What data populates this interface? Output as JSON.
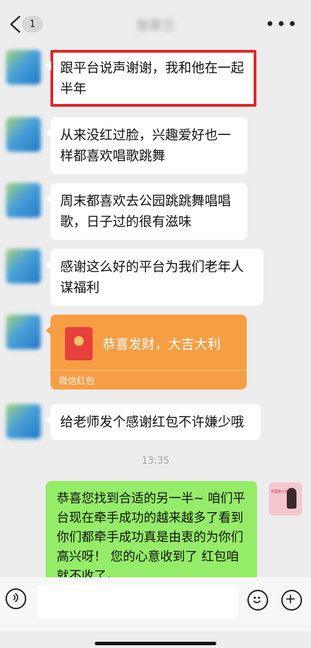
{
  "header": {
    "badge_count": "1",
    "title": "张翠兰"
  },
  "messages": [
    {
      "text": "跟平台说声谢谢，我和他在一起半年",
      "highlighted": true
    },
    {
      "text": "从来没红过脸，兴趣爱好也一样都喜欢唱歌跳舞"
    },
    {
      "text": "周末都喜欢去公园跳跳舞唱唱歌，日子过的很有滋味"
    },
    {
      "text": "感谢这么好的平台为我们老年人谋福利"
    }
  ],
  "red_packet": {
    "title": "恭喜发财，大吉大利",
    "footer": "微信红包"
  },
  "last_incoming": {
    "text": "给老师发个感谢红包不许嫌少哦"
  },
  "timestamp": "13:35",
  "my_message": {
    "text": "恭喜您找到合适的另一半~ 咱们平台现在牵手成功的越来越多了看到你们都牵手成功真是由衷的为你们高兴呀！ 您的心意收到了 红包咱就不收了。",
    "avatar_caption": "中国老人红娘网"
  },
  "colors": {
    "background": "#ededed",
    "incoming_bubble": "#ffffff",
    "outgoing_bubble": "#95ec69",
    "red_packet": "#f79e45",
    "highlight": "#e0262a"
  }
}
